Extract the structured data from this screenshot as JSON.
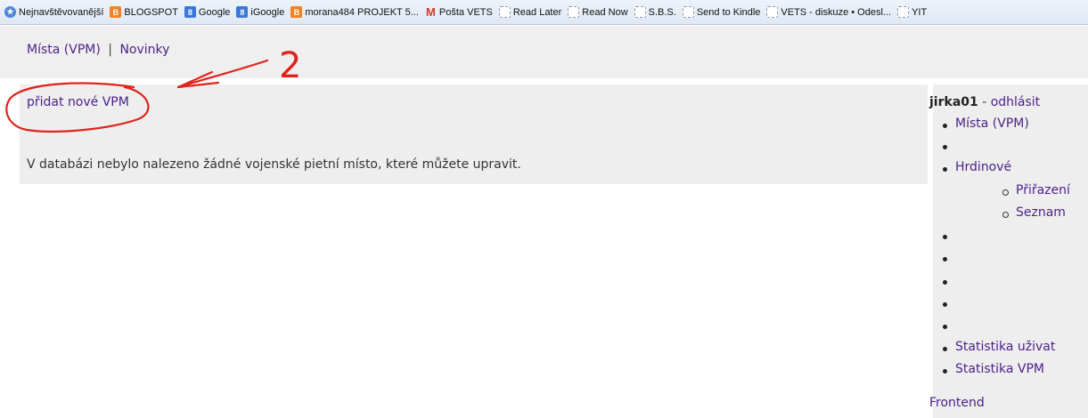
{
  "bookmarks": [
    {
      "label": "Nejnavštěvovanější",
      "icon": "star-icon"
    },
    {
      "label": "BLOGSPOT",
      "icon": "blogger-icon"
    },
    {
      "label": "Google",
      "icon": "google-icon"
    },
    {
      "label": "iGoogle",
      "icon": "google-icon"
    },
    {
      "label": "morana484 PROJEKT 5...",
      "icon": "blogger-icon"
    },
    {
      "label": "Pošta VETS",
      "icon": "mail-icon"
    },
    {
      "label": "Read Later",
      "icon": "page-icon"
    },
    {
      "label": "Read Now",
      "icon": "page-icon"
    },
    {
      "label": "S.B.S.",
      "icon": "page-icon"
    },
    {
      "label": "Send to Kindle",
      "icon": "page-icon"
    },
    {
      "label": "VETS - diskuze • Odesl...",
      "icon": "page-icon"
    },
    {
      "label": "YIT",
      "icon": "page-icon"
    }
  ],
  "topnav": {
    "link1": "Místa (VPM)",
    "separator": "|",
    "link2": "Novinky"
  },
  "main": {
    "add_link": "přidat nové VPM",
    "info_text": "V databázi nebylo nalezeno žádné vojenské pietní místo, které můžete upravit."
  },
  "sidebar": {
    "username": "jirka01",
    "dash": " - ",
    "logout": "odhlásit",
    "menu": [
      {
        "label": "Místa (VPM)"
      },
      {
        "label": ""
      },
      {
        "label": "Hrdinové"
      },
      {
        "label": "Přiřazení",
        "sub": true
      },
      {
        "label": "Seznam",
        "sub": true
      },
      {
        "label": ""
      },
      {
        "label": ""
      },
      {
        "label": ""
      },
      {
        "label": ""
      },
      {
        "label": ""
      },
      {
        "label": "Statistika uživat"
      },
      {
        "label": "Statistika VPM"
      }
    ],
    "frontend": "Frontend"
  },
  "annotation": {
    "number": "2",
    "color": "#e0231c"
  },
  "colors": {
    "link": "#4b1f8a",
    "panel_bg": "#eeeeee",
    "header_bg": "#efefef"
  }
}
